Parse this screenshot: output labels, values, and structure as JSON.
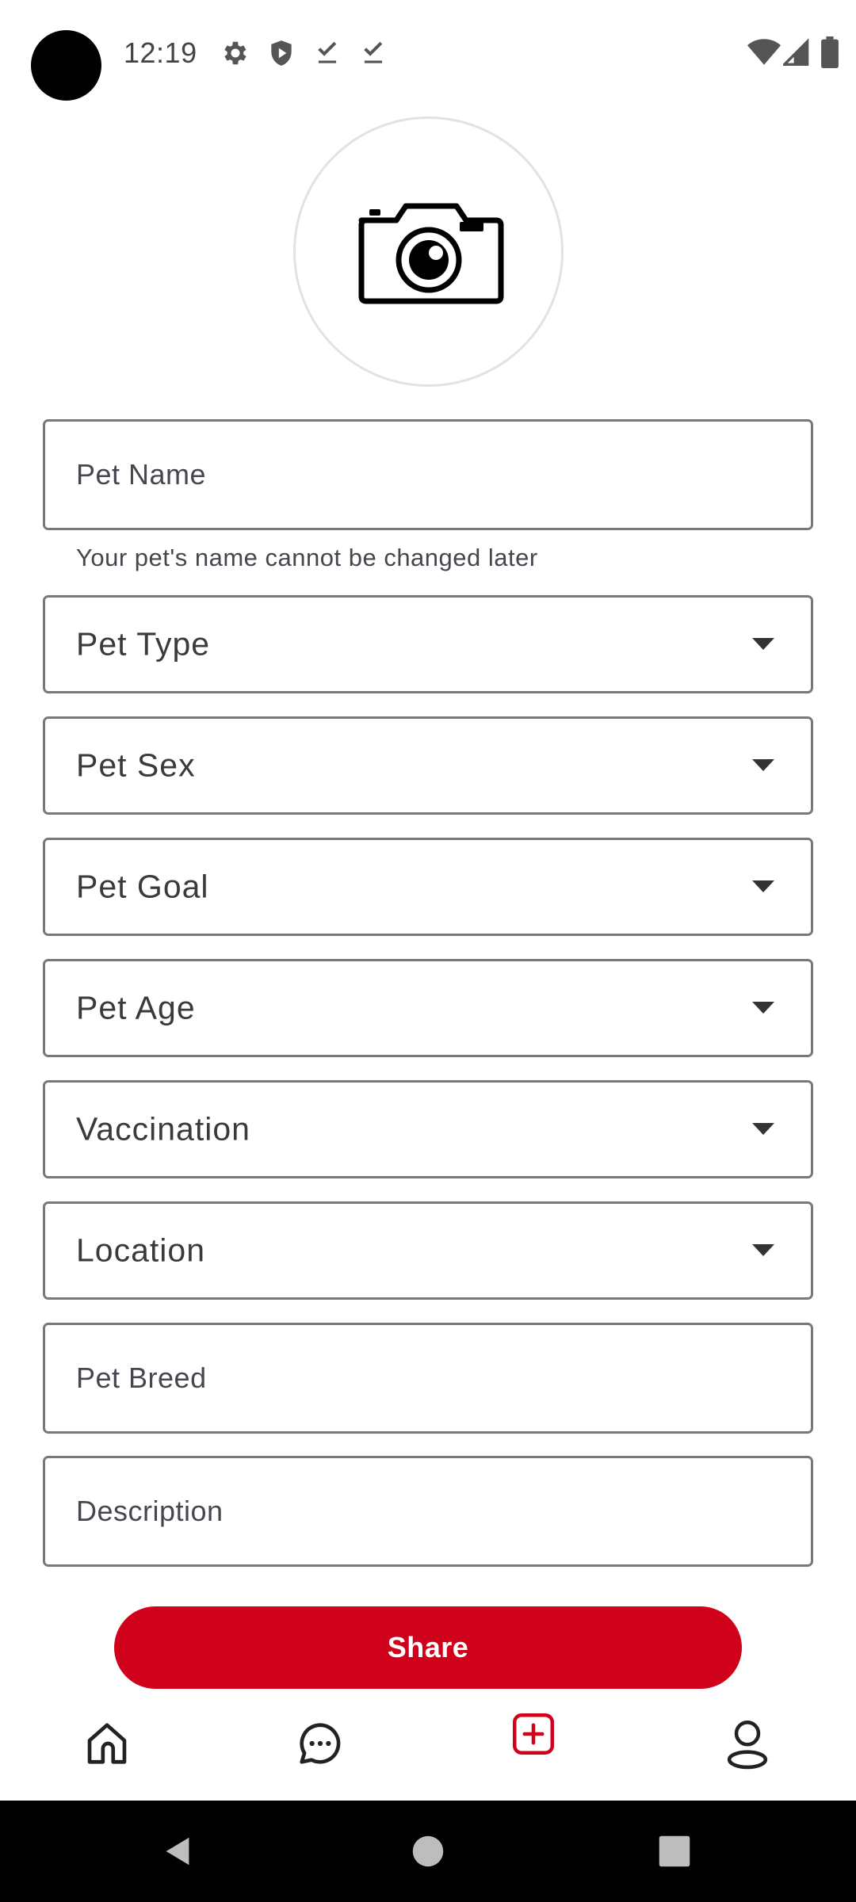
{
  "status_bar": {
    "time": "12:19",
    "left_icons": [
      "settings-icon",
      "shield-icon",
      "download-done-icon",
      "download-done-icon"
    ],
    "right_icons": [
      "wifi-icon",
      "signal-icon",
      "battery-icon"
    ]
  },
  "photo_picker": {
    "icon": "camera-icon"
  },
  "form": {
    "pet_name": {
      "placeholder": "Pet Name",
      "value": ""
    },
    "pet_name_helper": "Your pet's name cannot be changed later",
    "pet_type": {
      "label": "Pet Type"
    },
    "pet_sex": {
      "label": "Pet Sex"
    },
    "pet_goal": {
      "label": "Pet Goal"
    },
    "pet_age": {
      "label": "Pet Age"
    },
    "vaccination": {
      "label": "Vaccination"
    },
    "location": {
      "label": "Location"
    },
    "pet_breed": {
      "placeholder": "Pet Breed",
      "value": ""
    },
    "description": {
      "placeholder": "Description",
      "value": ""
    }
  },
  "share_button": {
    "label": "Share"
  },
  "bottom_nav": {
    "items": [
      {
        "icon": "home-icon"
      },
      {
        "icon": "chat-icon"
      },
      {
        "icon": "add-post-icon",
        "active": true
      },
      {
        "icon": "profile-icon"
      }
    ]
  },
  "colors": {
    "accent": "#d0021b",
    "outline": "#79767d",
    "text": "#49454f"
  }
}
